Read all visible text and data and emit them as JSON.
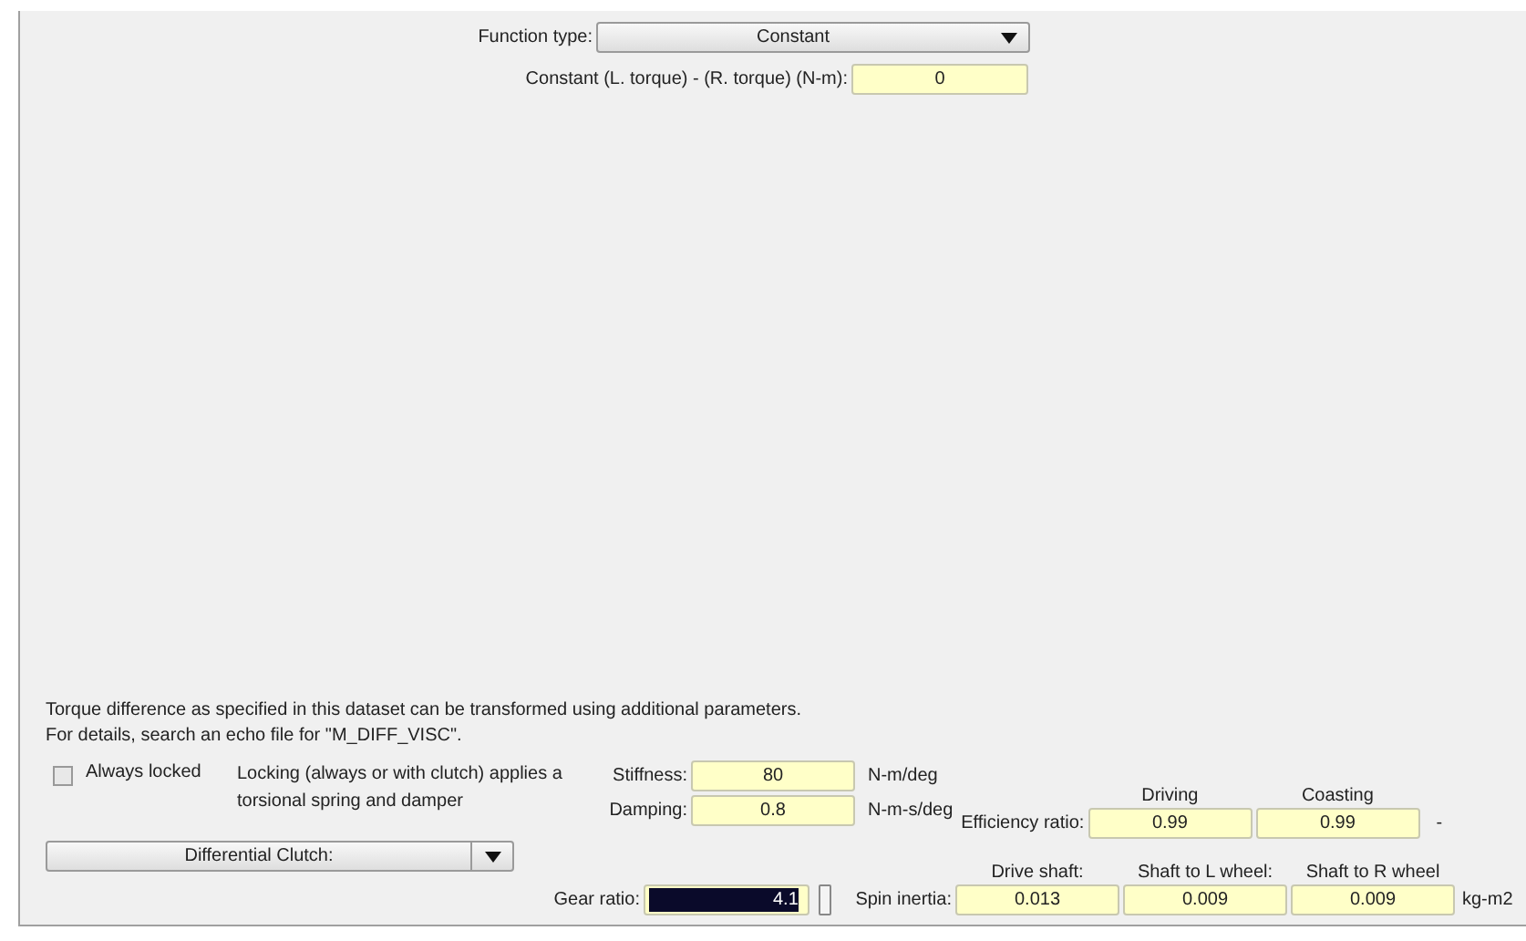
{
  "function_type": {
    "label": "Function type:",
    "value": "Constant"
  },
  "constant": {
    "label": "Constant (L. torque) - (R. torque) (N-m):",
    "value": "0"
  },
  "description": [
    "Torque difference as specified in this dataset can be transformed using additional parameters.",
    "For details, search an echo file for \"M_DIFF_VISC\"."
  ],
  "always_locked": {
    "label": "Always locked",
    "checked": false
  },
  "locking_note": "Locking (always or with clutch) applies a torsional spring and damper",
  "stiffness": {
    "label": "Stiffness:",
    "value": "80",
    "unit": "N-m/deg"
  },
  "damping": {
    "label": "Damping:",
    "value": "0.8",
    "unit": "N-m-s/deg"
  },
  "efficiency": {
    "label": "Efficiency ratio:",
    "columns": [
      "Driving",
      "Coasting"
    ],
    "values": [
      "0.99",
      "0.99"
    ],
    "unit": "-"
  },
  "clutch_dropdown": {
    "value": "Differential Clutch:"
  },
  "gear_ratio": {
    "label": "Gear ratio:",
    "value": "4.1",
    "selected": true
  },
  "spin_inertia": {
    "label": "Spin inertia:",
    "columns": [
      "Drive shaft:",
      "Shaft to L wheel:",
      "Shaft to R wheel"
    ],
    "values": [
      "0.013",
      "0.009",
      "0.009"
    ],
    "unit": "kg-m2"
  }
}
